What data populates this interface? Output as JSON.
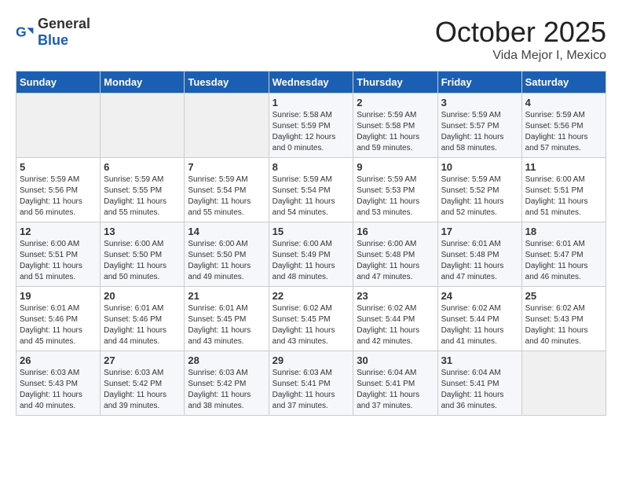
{
  "header": {
    "logo_general": "General",
    "logo_blue": "Blue",
    "month": "October 2025",
    "location": "Vida Mejor I, Mexico"
  },
  "days_of_week": [
    "Sunday",
    "Monday",
    "Tuesday",
    "Wednesday",
    "Thursday",
    "Friday",
    "Saturday"
  ],
  "weeks": [
    [
      null,
      null,
      null,
      {
        "day": 1,
        "sunrise": "5:58 AM",
        "sunset": "5:59 PM",
        "daylight": "12 hours and 0 minutes."
      },
      {
        "day": 2,
        "sunrise": "5:59 AM",
        "sunset": "5:58 PM",
        "daylight": "11 hours and 59 minutes."
      },
      {
        "day": 3,
        "sunrise": "5:59 AM",
        "sunset": "5:57 PM",
        "daylight": "11 hours and 58 minutes."
      },
      {
        "day": 4,
        "sunrise": "5:59 AM",
        "sunset": "5:56 PM",
        "daylight": "11 hours and 57 minutes."
      }
    ],
    [
      {
        "day": 5,
        "sunrise": "5:59 AM",
        "sunset": "5:56 PM",
        "daylight": "11 hours and 56 minutes."
      },
      {
        "day": 6,
        "sunrise": "5:59 AM",
        "sunset": "5:55 PM",
        "daylight": "11 hours and 55 minutes."
      },
      {
        "day": 7,
        "sunrise": "5:59 AM",
        "sunset": "5:54 PM",
        "daylight": "11 hours and 55 minutes."
      },
      {
        "day": 8,
        "sunrise": "5:59 AM",
        "sunset": "5:54 PM",
        "daylight": "11 hours and 54 minutes."
      },
      {
        "day": 9,
        "sunrise": "5:59 AM",
        "sunset": "5:53 PM",
        "daylight": "11 hours and 53 minutes."
      },
      {
        "day": 10,
        "sunrise": "5:59 AM",
        "sunset": "5:52 PM",
        "daylight": "11 hours and 52 minutes."
      },
      {
        "day": 11,
        "sunrise": "6:00 AM",
        "sunset": "5:51 PM",
        "daylight": "11 hours and 51 minutes."
      }
    ],
    [
      {
        "day": 12,
        "sunrise": "6:00 AM",
        "sunset": "5:51 PM",
        "daylight": "11 hours and 51 minutes."
      },
      {
        "day": 13,
        "sunrise": "6:00 AM",
        "sunset": "5:50 PM",
        "daylight": "11 hours and 50 minutes."
      },
      {
        "day": 14,
        "sunrise": "6:00 AM",
        "sunset": "5:50 PM",
        "daylight": "11 hours and 49 minutes."
      },
      {
        "day": 15,
        "sunrise": "6:00 AM",
        "sunset": "5:49 PM",
        "daylight": "11 hours and 48 minutes."
      },
      {
        "day": 16,
        "sunrise": "6:00 AM",
        "sunset": "5:48 PM",
        "daylight": "11 hours and 47 minutes."
      },
      {
        "day": 17,
        "sunrise": "6:01 AM",
        "sunset": "5:48 PM",
        "daylight": "11 hours and 47 minutes."
      },
      {
        "day": 18,
        "sunrise": "6:01 AM",
        "sunset": "5:47 PM",
        "daylight": "11 hours and 46 minutes."
      }
    ],
    [
      {
        "day": 19,
        "sunrise": "6:01 AM",
        "sunset": "5:46 PM",
        "daylight": "11 hours and 45 minutes."
      },
      {
        "day": 20,
        "sunrise": "6:01 AM",
        "sunset": "5:46 PM",
        "daylight": "11 hours and 44 minutes."
      },
      {
        "day": 21,
        "sunrise": "6:01 AM",
        "sunset": "5:45 PM",
        "daylight": "11 hours and 43 minutes."
      },
      {
        "day": 22,
        "sunrise": "6:02 AM",
        "sunset": "5:45 PM",
        "daylight": "11 hours and 43 minutes."
      },
      {
        "day": 23,
        "sunrise": "6:02 AM",
        "sunset": "5:44 PM",
        "daylight": "11 hours and 42 minutes."
      },
      {
        "day": 24,
        "sunrise": "6:02 AM",
        "sunset": "5:44 PM",
        "daylight": "11 hours and 41 minutes."
      },
      {
        "day": 25,
        "sunrise": "6:02 AM",
        "sunset": "5:43 PM",
        "daylight": "11 hours and 40 minutes."
      }
    ],
    [
      {
        "day": 26,
        "sunrise": "6:03 AM",
        "sunset": "5:43 PM",
        "daylight": "11 hours and 40 minutes."
      },
      {
        "day": 27,
        "sunrise": "6:03 AM",
        "sunset": "5:42 PM",
        "daylight": "11 hours and 39 minutes."
      },
      {
        "day": 28,
        "sunrise": "6:03 AM",
        "sunset": "5:42 PM",
        "daylight": "11 hours and 38 minutes."
      },
      {
        "day": 29,
        "sunrise": "6:03 AM",
        "sunset": "5:41 PM",
        "daylight": "11 hours and 37 minutes."
      },
      {
        "day": 30,
        "sunrise": "6:04 AM",
        "sunset": "5:41 PM",
        "daylight": "11 hours and 37 minutes."
      },
      {
        "day": 31,
        "sunrise": "6:04 AM",
        "sunset": "5:41 PM",
        "daylight": "11 hours and 36 minutes."
      },
      null
    ]
  ]
}
